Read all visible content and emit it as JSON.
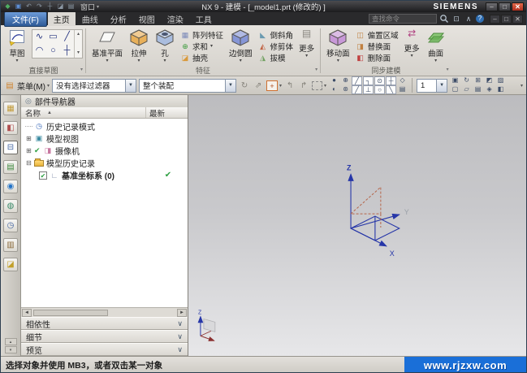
{
  "window": {
    "title": "NX 9 - 建模 - [_model1.prt (修改的) ]",
    "brand": "SIEMENS",
    "window_menu": "窗口",
    "qat": [
      "◆",
      "▣",
      "↶",
      "↷",
      "┼",
      "◪",
      "▤"
    ]
  },
  "menubar": {
    "file": "文件(F)",
    "tabs": [
      "主页",
      "曲线",
      "分析",
      "视图",
      "渲染",
      "工具"
    ],
    "search_placeholder": "查找命令"
  },
  "ribbon": {
    "sketch": "草图",
    "datum_plane": "基准平面",
    "extrude": "拉伸",
    "hole": "孔",
    "pattern_feature": "阵列特征",
    "unite": "求和",
    "shell": "抽壳",
    "edge_blend": "边倒圆",
    "chamfer": "倒斜角",
    "trim_body": "修剪体",
    "draft": "拔模",
    "more_feature": "更多",
    "move_face": "移动面",
    "offset_region": "偏置区域",
    "replace_face": "替换面",
    "delete_face": "删除面",
    "more_sync": "更多",
    "surface": "曲面",
    "groups": {
      "direct_sketch": "直接草图",
      "feature": "特征",
      "sync": "同步建模"
    },
    "pal1": [
      "∿",
      "▭",
      "╱"
    ],
    "pal2": [
      "◠",
      "○",
      "┼"
    ]
  },
  "toolbar2": {
    "menu": "菜单(M)",
    "filter_value": "没有选择过滤器",
    "scope_value": "整个装配",
    "layer_value": "1",
    "pre_icons": [
      "↻",
      "⇗",
      "+",
      "↰",
      "↱"
    ],
    "snap_row1": [
      "●",
      "⊕",
      "╱",
      "┐",
      "⊙",
      "┼",
      "◇"
    ],
    "snap_row2": [
      "◐",
      "⊛",
      "╱",
      "⊥",
      "○",
      "╲",
      "▤"
    ],
    "view_row1": [
      "▣",
      "↻",
      "⊞",
      "◩",
      "▨"
    ],
    "view_row2": [
      "▢",
      "▱",
      "▤",
      "◈",
      "◧"
    ]
  },
  "resources": [
    "▦",
    "◧",
    "⊟",
    "▤",
    "◉",
    "◍",
    "◷",
    "▥",
    "◪"
  ],
  "navigator": {
    "title": "部件导航器",
    "col_name": "名称",
    "col_latest": "最新",
    "items": [
      {
        "label": "历史记录模式"
      },
      {
        "label": "模型视图"
      },
      {
        "label": "摄像机"
      },
      {
        "label": "模型历史记录"
      },
      {
        "label": "基准坐标系 (0)",
        "latest": "✔"
      }
    ],
    "sections": [
      "相依性",
      "细节",
      "预览"
    ]
  },
  "viewport": {
    "x": "X",
    "y": "Y",
    "z": "Z"
  },
  "statusbar": {
    "message": "选择对象并使用 MB3，或者双击某一对象",
    "watermark": "www.rjzxw.com"
  },
  "icons": {
    "dd": "▼",
    "dds": "▾",
    "up_s": "▴",
    "exp": "⊞",
    "col": "⊟",
    "chk": "✔",
    "sect": "∨",
    "left": "◄",
    "right": "►",
    "min": "–",
    "max": "□",
    "close": "✕",
    "help": "?",
    "fit": "⊡",
    "caret": "∧",
    "clock": "◷",
    "mview": "▣",
    "camera": "◨",
    "csys": "∟",
    "pin": "◎",
    "sort": "▲",
    "menu_chip": "▤",
    "more_chip": "▤",
    "sync_more": "⇄",
    "pattern": "▦",
    "unite": "⊕",
    "shell": "◪",
    "chamfer": "◣",
    "trim": "◭",
    "draft": "◮",
    "offset": "◫",
    "replace": "◨",
    "delete": "◧"
  }
}
